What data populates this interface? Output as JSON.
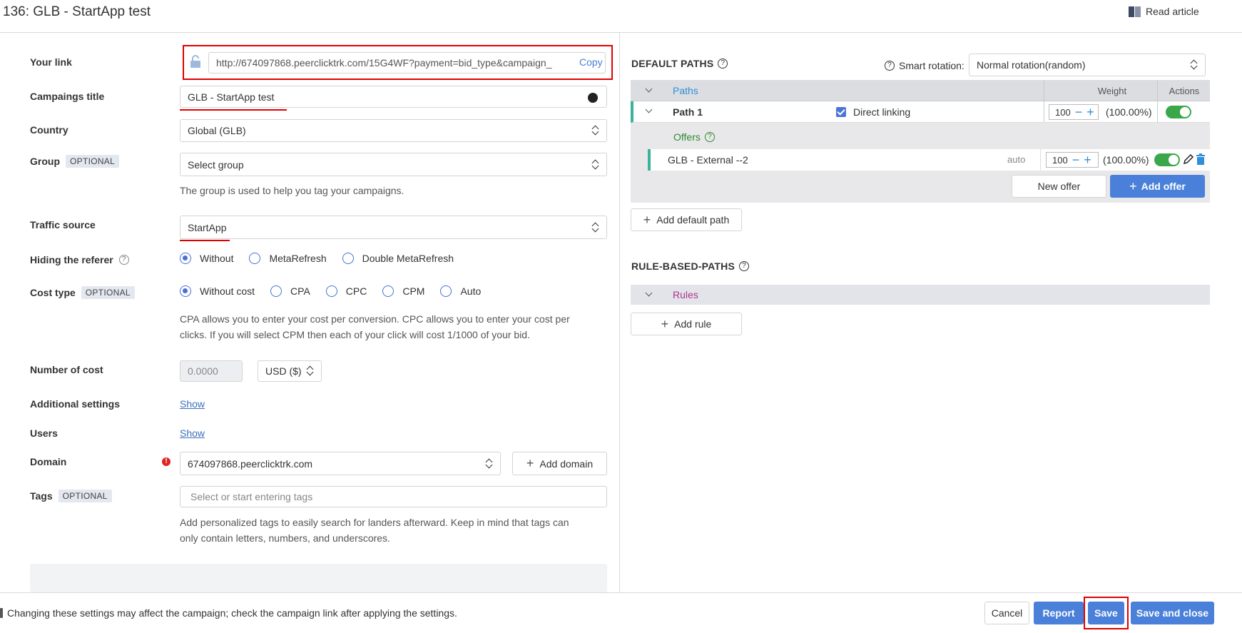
{
  "header": {
    "title": "136: GLB - StartApp test",
    "read_article": "Read article"
  },
  "form": {
    "your_link": {
      "label": "Your link",
      "value": "http://674097868.peerclicktrk.com/15G4WF?payment=bid_type&campaign_",
      "copy": "Copy"
    },
    "campaign_title": {
      "label": "Campaings title",
      "value": "GLB - StartApp test"
    },
    "country": {
      "label": "Country",
      "value": "Global (GLB)"
    },
    "group": {
      "label": "Group",
      "badge": "OPTIONAL",
      "value": "Select group",
      "hint": "The group is used to help you tag your campaigns."
    },
    "traffic_source": {
      "label": "Traffic source",
      "value": "StartApp"
    },
    "hiding_referer": {
      "label": "Hiding the referer",
      "help": "?",
      "options": [
        "Without",
        "MetaRefresh",
        "Double MetaRefresh"
      ],
      "selected": "Without"
    },
    "cost_type": {
      "label": "Cost type",
      "badge": "OPTIONAL",
      "options": [
        "Without cost",
        "CPA",
        "CPC",
        "CPM",
        "Auto"
      ],
      "selected": "Without cost",
      "hint_line1": "CPA allows you to enter your cost per conversion. CPC allows you to enter your cost per",
      "hint_line2": "clicks. If you will select CPM then each of your click will cost 1/1000 of your bid."
    },
    "number_of_cost": {
      "label": "Number of cost",
      "value": "0.0000",
      "currency": "USD ($)"
    },
    "additional_settings": {
      "label": "Additional settings",
      "link": "Show"
    },
    "users": {
      "label": "Users",
      "link": "Show"
    },
    "domain": {
      "label": "Domain",
      "error_mark": "!",
      "value": "674097868.peerclicktrk.com",
      "add_button": "Add domain"
    },
    "tags": {
      "label": "Tags",
      "badge": "OPTIONAL",
      "placeholder": "Select or start entering tags",
      "hint_line1": "Add personalized tags to easily search for landers afterward. Keep in mind that tags can",
      "hint_line2": "only contain letters, numbers, and underscores."
    }
  },
  "default_paths": {
    "title": "DEFAULT PATHS",
    "help": "?",
    "smart_rotation_label": "Smart rotation:",
    "smart_rotation_value": "Normal rotation(random)",
    "table_headers": {
      "paths": "Paths",
      "weight": "Weight",
      "actions": "Actions"
    },
    "path": {
      "name": "Path 1",
      "direct_linking": "Direct linking",
      "weight": "100",
      "percent": "(100.00%)",
      "enabled": true
    },
    "offers_label": "Offers",
    "offer": {
      "name": "GLB - External --2",
      "mode": "auto",
      "weight": "100",
      "percent": "(100.00%)",
      "enabled": true
    },
    "new_offer": "New offer",
    "add_offer": "Add offer",
    "add_default_path": "Add default path"
  },
  "rule_paths": {
    "title": "RULE-BASED-PATHS",
    "help": "?",
    "rules_label": "Rules",
    "add_rule": "Add rule"
  },
  "footer": {
    "warning": "Changing these settings may affect the campaign; check the campaign link after applying the settings.",
    "cancel": "Cancel",
    "report": "Report",
    "save": "Save",
    "save_close": "Save and close"
  },
  "colors": {
    "accent": "#4a80d9",
    "highlight": "#e00000",
    "success": "#3aa84a",
    "path_marker": "#3bb39a",
    "rules_text": "#b0368c",
    "offers_text": "#2e8a2e"
  }
}
